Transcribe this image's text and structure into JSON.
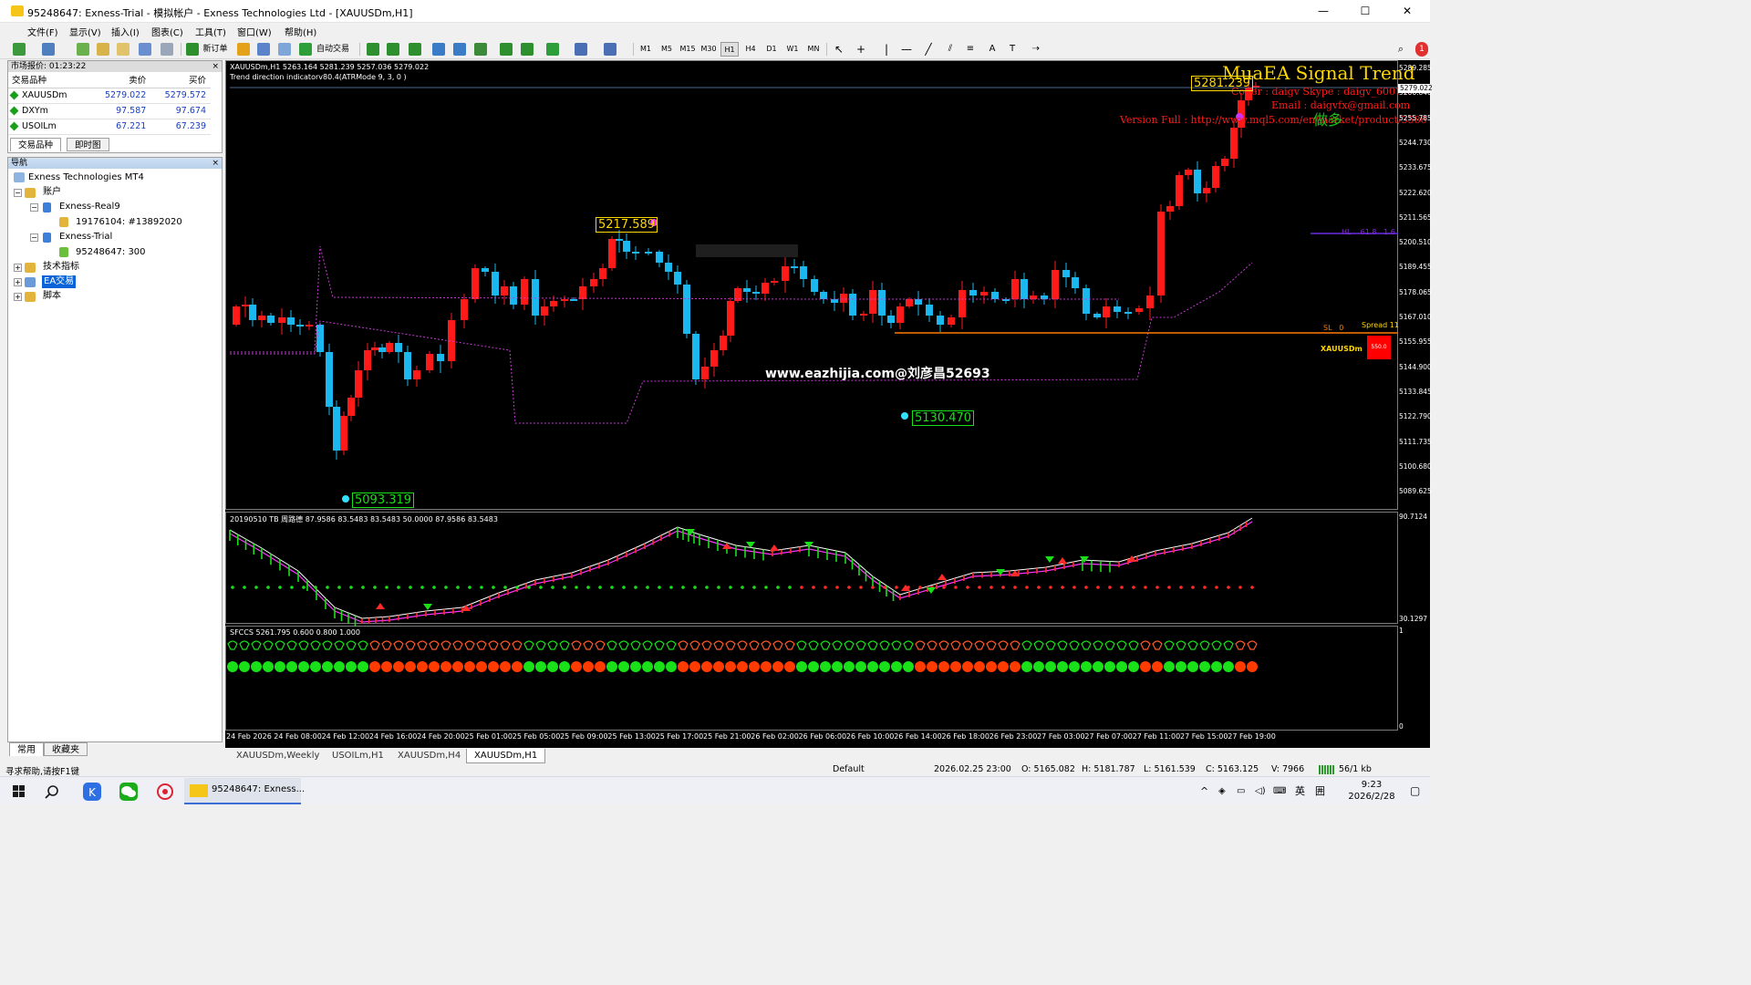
{
  "window": {
    "title": "95248647: Exness-Trial - 模拟帐户 - Exness Technologies Ltd - [XAUUSDm,H1]",
    "minimize": "—",
    "maximize": "☐",
    "close": "✕"
  },
  "menu": [
    "文件(F)",
    "显示(V)",
    "插入(I)",
    "图表(C)",
    "工具(T)",
    "窗口(W)",
    "帮助(H)"
  ],
  "toolbar": {
    "new_order": "新订单",
    "auto_trading": "自动交易",
    "timeframes": [
      "M1",
      "M5",
      "M15",
      "M30",
      "H1",
      "H4",
      "D1",
      "W1",
      "MN"
    ],
    "active_timeframe": "H1"
  },
  "market_watch": {
    "title": "市场报价: 01:23:22",
    "headers": [
      "交易品种",
      "卖价",
      "买价"
    ],
    "rows": [
      {
        "symbol": "XAUUSDm",
        "bid": "5279.022",
        "ask": "5279.572"
      },
      {
        "symbol": "DXYm",
        "bid": "97.587",
        "ask": "97.674"
      },
      {
        "symbol": "USOILm",
        "bid": "67.221",
        "ask": "67.239"
      }
    ],
    "tabs": [
      "交易品种",
      "即时图"
    ]
  },
  "navigator": {
    "title": "导航",
    "root": "Exness Technologies MT4",
    "accounts": "账户",
    "real": "Exness-Real9",
    "real_acct": "19176104: #13892020",
    "trial": "Exness-Trial",
    "trial_acct": "95248647: 300",
    "indicators": "技术指标",
    "ea": "EA交易",
    "scripts": "脚本",
    "tabs": [
      "常用",
      "收藏夹"
    ]
  },
  "chart": {
    "symbol_line": "XAUUSDm,H1  5263.164 5281.239 5257.036 5279.022",
    "indicator_line": "Trend direction indicatorv80.4(ATRMode 9, 3, 0 )",
    "ea_title": "MuaEA Signal Trend",
    "ea_coder": "Coder : daigv Skype : daigv_60074",
    "ea_email": "Email : daigvfx@gmail.com",
    "ea_version": "Version Full : http://www.mql5.com/en/market/product/3586",
    "ea_action": "做多",
    "watermark": "www.eazhijia.com@刘彦昌52693",
    "tag_high_recent": "5281.239",
    "tag_high_mid": "5217.589",
    "tag_low_mid": "5130.470",
    "tag_low_left": "5093.319",
    "sl_label": "SL",
    "sl_value": "0",
    "spread_label": "Spread",
    "spread_value": "11",
    "hl_label": "HL",
    "hl_value": "61.8",
    "hl_ratio": "1.6",
    "symbol_badge": "XAUUSDm",
    "badge_value": "550.0",
    "current_price": "5279.022",
    "price_ticks": [
      "5289.285",
      "5266.840",
      "5255.785",
      "5244.730",
      "5233.675",
      "5222.620",
      "5211.565",
      "5200.510",
      "5189.455",
      "5178.065",
      "5167.010",
      "5155.955",
      "5144.900",
      "5133.845",
      "5122.790",
      "5111.735",
      "5100.680",
      "5089.625"
    ],
    "time_ticks": [
      "24 Feb 2026",
      "24 Feb 08:00",
      "24 Feb 12:00",
      "24 Feb 16:00",
      "24 Feb 20:00",
      "25 Feb 01:00",
      "25 Feb 05:00",
      "25 Feb 09:00",
      "25 Feb 13:00",
      "25 Feb 17:00",
      "25 Feb 21:00",
      "26 Feb 02:00",
      "26 Feb 06:00",
      "26 Feb 10:00",
      "26 Feb 14:00",
      "26 Feb 18:00",
      "26 Feb 23:00",
      "27 Feb 03:00",
      "27 Feb 07:00",
      "27 Feb 11:00",
      "27 Feb 15:00",
      "27 Feb 19:00"
    ],
    "ind1_label": "20190510 TB 周路德 87.9586 83.5483 83.5483 50.0000 87.9586 83.5483",
    "ind1_max": "90.7124",
    "ind1_min": "30.1297",
    "ind2_label": "SFCCS 5261.795 0.600 0.800 1.000",
    "ind2_max": "1",
    "ind2_min": "0"
  },
  "chart_tabs": [
    "XAUUSDm,Weekly",
    "USOILm,H1",
    "XAUUSDm,H4",
    "XAUUSDm,H1"
  ],
  "status": {
    "help": "寻求帮助,请按F1键",
    "profile": "Default",
    "datetime": "2026.02.25 23:00",
    "open": "O: 5165.082",
    "high": "H: 5181.787",
    "low": "L: 5161.539",
    "close": "C: 5163.125",
    "volume": "V: 7966",
    "traffic": "56/1 kb"
  },
  "taskbar": {
    "app_label": "95248647: Exness...",
    "time": "9:23",
    "date": "2026/2/28",
    "ime": "英",
    "ime2": "囲"
  },
  "colors": {
    "bull": "#ff1a1a",
    "bear": "#1bb8f0",
    "accent": "#ffd700",
    "envelope": "#c43bd1",
    "sl_line": "#ff7a00"
  }
}
